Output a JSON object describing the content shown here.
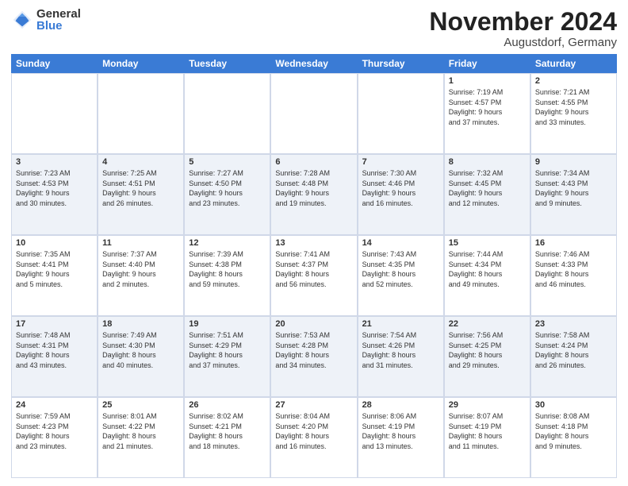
{
  "logo": {
    "general": "General",
    "blue": "Blue"
  },
  "title": "November 2024",
  "location": "Augustdorf, Germany",
  "header": {
    "days": [
      "Sunday",
      "Monday",
      "Tuesday",
      "Wednesday",
      "Thursday",
      "Friday",
      "Saturday"
    ]
  },
  "weeks": [
    [
      {
        "day": "",
        "detail": ""
      },
      {
        "day": "",
        "detail": ""
      },
      {
        "day": "",
        "detail": ""
      },
      {
        "day": "",
        "detail": ""
      },
      {
        "day": "",
        "detail": ""
      },
      {
        "day": "1",
        "detail": "Sunrise: 7:19 AM\nSunset: 4:57 PM\nDaylight: 9 hours\nand 37 minutes."
      },
      {
        "day": "2",
        "detail": "Sunrise: 7:21 AM\nSunset: 4:55 PM\nDaylight: 9 hours\nand 33 minutes."
      }
    ],
    [
      {
        "day": "3",
        "detail": "Sunrise: 7:23 AM\nSunset: 4:53 PM\nDaylight: 9 hours\nand 30 minutes."
      },
      {
        "day": "4",
        "detail": "Sunrise: 7:25 AM\nSunset: 4:51 PM\nDaylight: 9 hours\nand 26 minutes."
      },
      {
        "day": "5",
        "detail": "Sunrise: 7:27 AM\nSunset: 4:50 PM\nDaylight: 9 hours\nand 23 minutes."
      },
      {
        "day": "6",
        "detail": "Sunrise: 7:28 AM\nSunset: 4:48 PM\nDaylight: 9 hours\nand 19 minutes."
      },
      {
        "day": "7",
        "detail": "Sunrise: 7:30 AM\nSunset: 4:46 PM\nDaylight: 9 hours\nand 16 minutes."
      },
      {
        "day": "8",
        "detail": "Sunrise: 7:32 AM\nSunset: 4:45 PM\nDaylight: 9 hours\nand 12 minutes."
      },
      {
        "day": "9",
        "detail": "Sunrise: 7:34 AM\nSunset: 4:43 PM\nDaylight: 9 hours\nand 9 minutes."
      }
    ],
    [
      {
        "day": "10",
        "detail": "Sunrise: 7:35 AM\nSunset: 4:41 PM\nDaylight: 9 hours\nand 5 minutes."
      },
      {
        "day": "11",
        "detail": "Sunrise: 7:37 AM\nSunset: 4:40 PM\nDaylight: 9 hours\nand 2 minutes."
      },
      {
        "day": "12",
        "detail": "Sunrise: 7:39 AM\nSunset: 4:38 PM\nDaylight: 8 hours\nand 59 minutes."
      },
      {
        "day": "13",
        "detail": "Sunrise: 7:41 AM\nSunset: 4:37 PM\nDaylight: 8 hours\nand 56 minutes."
      },
      {
        "day": "14",
        "detail": "Sunrise: 7:43 AM\nSunset: 4:35 PM\nDaylight: 8 hours\nand 52 minutes."
      },
      {
        "day": "15",
        "detail": "Sunrise: 7:44 AM\nSunset: 4:34 PM\nDaylight: 8 hours\nand 49 minutes."
      },
      {
        "day": "16",
        "detail": "Sunrise: 7:46 AM\nSunset: 4:33 PM\nDaylight: 8 hours\nand 46 minutes."
      }
    ],
    [
      {
        "day": "17",
        "detail": "Sunrise: 7:48 AM\nSunset: 4:31 PM\nDaylight: 8 hours\nand 43 minutes."
      },
      {
        "day": "18",
        "detail": "Sunrise: 7:49 AM\nSunset: 4:30 PM\nDaylight: 8 hours\nand 40 minutes."
      },
      {
        "day": "19",
        "detail": "Sunrise: 7:51 AM\nSunset: 4:29 PM\nDaylight: 8 hours\nand 37 minutes."
      },
      {
        "day": "20",
        "detail": "Sunrise: 7:53 AM\nSunset: 4:28 PM\nDaylight: 8 hours\nand 34 minutes."
      },
      {
        "day": "21",
        "detail": "Sunrise: 7:54 AM\nSunset: 4:26 PM\nDaylight: 8 hours\nand 31 minutes."
      },
      {
        "day": "22",
        "detail": "Sunrise: 7:56 AM\nSunset: 4:25 PM\nDaylight: 8 hours\nand 29 minutes."
      },
      {
        "day": "23",
        "detail": "Sunrise: 7:58 AM\nSunset: 4:24 PM\nDaylight: 8 hours\nand 26 minutes."
      }
    ],
    [
      {
        "day": "24",
        "detail": "Sunrise: 7:59 AM\nSunset: 4:23 PM\nDaylight: 8 hours\nand 23 minutes."
      },
      {
        "day": "25",
        "detail": "Sunrise: 8:01 AM\nSunset: 4:22 PM\nDaylight: 8 hours\nand 21 minutes."
      },
      {
        "day": "26",
        "detail": "Sunrise: 8:02 AM\nSunset: 4:21 PM\nDaylight: 8 hours\nand 18 minutes."
      },
      {
        "day": "27",
        "detail": "Sunrise: 8:04 AM\nSunset: 4:20 PM\nDaylight: 8 hours\nand 16 minutes."
      },
      {
        "day": "28",
        "detail": "Sunrise: 8:06 AM\nSunset: 4:19 PM\nDaylight: 8 hours\nand 13 minutes."
      },
      {
        "day": "29",
        "detail": "Sunrise: 8:07 AM\nSunset: 4:19 PM\nDaylight: 8 hours\nand 11 minutes."
      },
      {
        "day": "30",
        "detail": "Sunrise: 8:08 AM\nSunset: 4:18 PM\nDaylight: 8 hours\nand 9 minutes."
      }
    ]
  ]
}
